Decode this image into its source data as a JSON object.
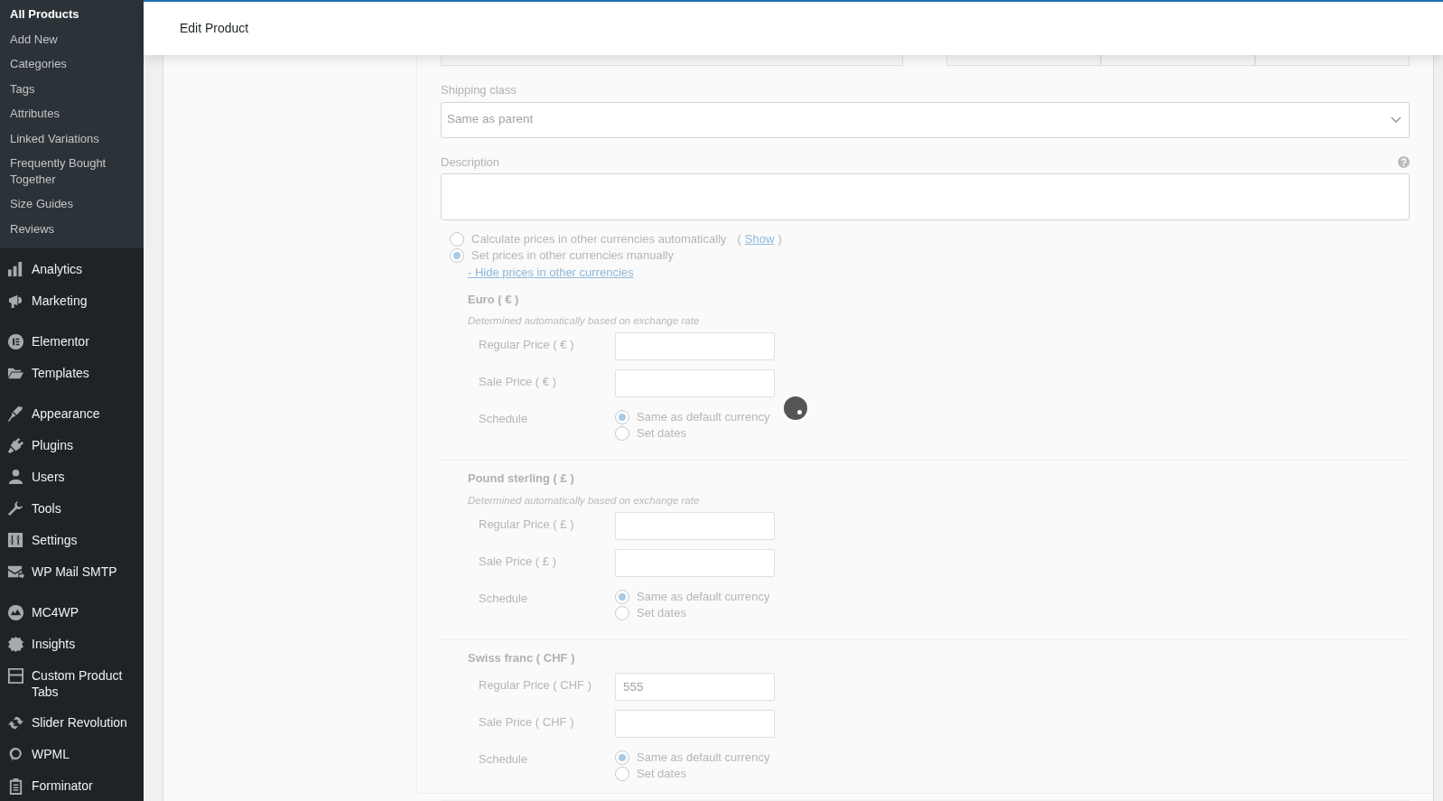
{
  "sidebar": {
    "submenu": [
      {
        "label": "All Products",
        "selected": true
      },
      {
        "label": "Add New",
        "selected": false
      },
      {
        "label": "Categories",
        "selected": false
      },
      {
        "label": "Tags",
        "selected": false
      },
      {
        "label": "Attributes",
        "selected": false
      },
      {
        "label": "Linked Variations",
        "selected": false
      },
      {
        "label": "Frequently Bought Together",
        "selected": false
      },
      {
        "label": "Size Guides",
        "selected": false
      },
      {
        "label": "Reviews",
        "selected": false
      }
    ],
    "menu_groups": [
      {
        "items": [
          {
            "label": "Analytics"
          },
          {
            "label": "Marketing"
          }
        ]
      },
      {
        "items": [
          {
            "label": "Elementor"
          },
          {
            "label": "Templates"
          }
        ]
      },
      {
        "items": [
          {
            "label": "Appearance"
          },
          {
            "label": "Plugins"
          },
          {
            "label": "Users"
          },
          {
            "label": "Tools"
          },
          {
            "label": "Settings"
          },
          {
            "label": "WP Mail SMTP"
          }
        ]
      },
      {
        "items": [
          {
            "label": "MC4WP"
          },
          {
            "label": "Insights"
          },
          {
            "label": "Custom Product Tabs"
          },
          {
            "label": "Slider Revolution"
          },
          {
            "label": "WPML"
          },
          {
            "label": "Forminator"
          }
        ]
      }
    ]
  },
  "header": {
    "title": "Edit Product"
  },
  "form": {
    "shipping_class": {
      "label": "Shipping class",
      "value": "Same as parent"
    },
    "description": {
      "label": "Description"
    },
    "pricing_mode": [
      {
        "label": "Calculate prices in other currencies automatically",
        "selected": false
      },
      {
        "label": "Set prices in other currencies manually",
        "selected": true
      }
    ],
    "show_prefix": "(",
    "show_link": "Show",
    "show_suffix": ")",
    "hide_link": "- Hide prices in other currencies",
    "currencies": [
      {
        "name": "Euro ( € )",
        "note": "Determined automatically based on exchange rate",
        "fields": [
          {
            "label": "Regular Price ( € )"
          },
          {
            "label": "Sale Price ( € )"
          }
        ],
        "schedule": {
          "label": "Schedule",
          "options": [
            {
              "label": "Same as default currency",
              "selected": true
            },
            {
              "label": "Set dates",
              "selected": false
            }
          ]
        }
      },
      {
        "name": "Pound sterling ( £ )",
        "note": "Determined automatically based on exchange rate",
        "fields": [
          {
            "label": "Regular Price ( £ )"
          },
          {
            "label": "Sale Price ( £ )"
          }
        ],
        "schedule": {
          "label": "Schedule",
          "options": [
            {
              "label": "Same as default currency",
              "selected": true
            },
            {
              "label": "Set dates",
              "selected": false
            }
          ]
        }
      },
      {
        "name": "Swiss franc ( CHF )",
        "fields": [
          {
            "label": "Regular Price ( CHF )",
            "value": "555"
          },
          {
            "label": "Sale Price ( CHF )"
          }
        ],
        "schedule": {
          "label": "Schedule",
          "options": [
            {
              "label": "Same as default currency",
              "selected": true
            },
            {
              "label": "Set dates",
              "selected": false
            }
          ]
        }
      }
    ],
    "loading": true
  }
}
